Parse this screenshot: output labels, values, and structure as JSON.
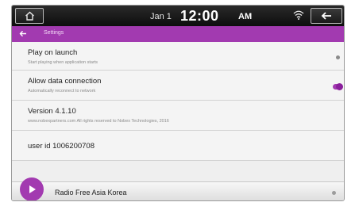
{
  "status": {
    "date": "Jan 1",
    "time": "12:00",
    "ampm": "AM",
    "icons": [
      "home-icon",
      "wifi-icon",
      "back-arrow-icon"
    ]
  },
  "titlebar": {
    "title": "Settings",
    "back_icon": "back-arrow-icon"
  },
  "settings": [
    {
      "label": "Play on launch",
      "sub": "Start playing when application starts",
      "toggle": "off"
    },
    {
      "label": "Allow data connection",
      "sub": "Automatically reconnect to network",
      "toggle": "on"
    },
    {
      "label": "Version 4.1.10",
      "sub": "www.nobexpartners.com  All rights reserved to Nobex Technologies, 2016"
    },
    {
      "label": "user id 1006200708"
    }
  ],
  "player": {
    "station": "Radio Free Asia Korea",
    "play_icon": "play-icon"
  },
  "colors": {
    "accent": "#a23ab0",
    "statusbar": "#1a1a1a",
    "background": "#f4f4f4"
  }
}
